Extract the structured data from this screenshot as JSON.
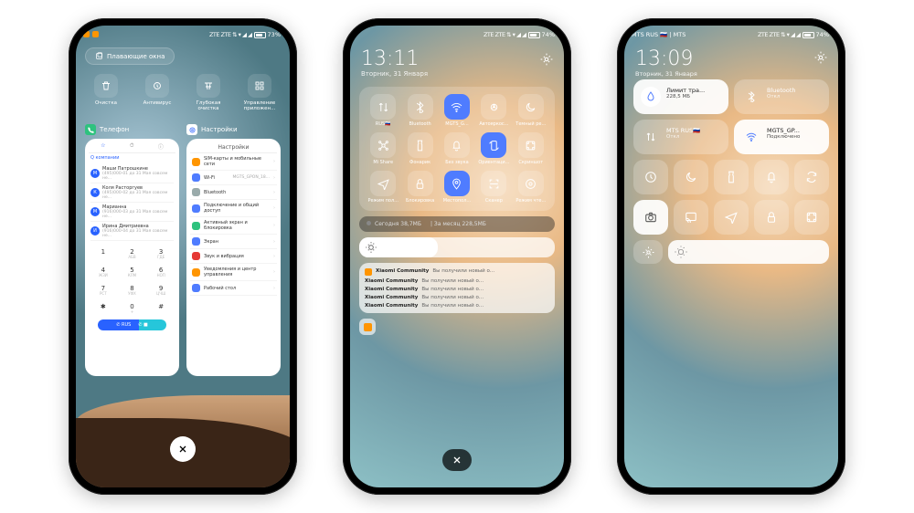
{
  "phone1": {
    "status": {
      "battery": "73%",
      "signals": "ZTE ZTE ⇅ ▾ ◢ ◢"
    },
    "pill": "Плавающие окна",
    "tools": [
      {
        "l": "Очистка",
        "i": "trash"
      },
      {
        "l": "Антивирус",
        "i": "shield"
      },
      {
        "l": "Глубокая очистка",
        "i": "broom"
      },
      {
        "l": "Управление приложен...",
        "i": "grid"
      }
    ],
    "card1": {
      "h": "Телефон",
      "tabs": [
        "☆",
        "⏱",
        "ⓘ"
      ],
      "search": "Q компании",
      "rows": [
        {
          "n": "Маши Патрошкине",
          "m": "(495)000-01  до 31 Мая совсем не..."
        },
        {
          "n": "Коля Расторгуев",
          "m": "(495)000-02  до 31 Мая совсем не..."
        },
        {
          "n": "Марианна",
          "m": "(916)000-03  до 31 Мая совсем не..."
        },
        {
          "n": "Ирина Дмитриевна",
          "m": "(916)000-04  до 31 Мая совсем не..."
        }
      ],
      "keys": [
        "1",
        "2",
        "3",
        "4",
        "5",
        "6",
        "7",
        "8",
        "9",
        "✱",
        "0",
        "#"
      ],
      "subs": [
        "",
        "АБВ",
        "ГДЕ",
        "ЖЗИ",
        "КЛМ",
        "НОП",
        "РСТ",
        "УФХ",
        "ЦЧШ",
        "",
        "+",
        ""
      ]
    },
    "card2": {
      "h": "Настройки",
      "title": "Настройки",
      "rows": [
        {
          "c": "#ff9500",
          "l": "SIM-карты и мобильные сети"
        },
        {
          "c": "#4f7cff",
          "l": "Wi-Fi",
          "r": "MGTS_GPON_18..."
        },
        {
          "c": "#9aa",
          "l": "Bluetooth"
        },
        {
          "c": "#4f7cff",
          "l": "Подключение и общий доступ"
        },
        {
          "c": "#2ec27e",
          "l": "Активный экран и блокировка"
        },
        {
          "c": "#4f7cff",
          "l": "Экран"
        },
        {
          "c": "#e53935",
          "l": "Звук и вибрация"
        },
        {
          "c": "#ff9500",
          "l": "Уведомления и центр управления"
        },
        {
          "c": "#4f7cff",
          "l": "Рабочий стол"
        }
      ]
    }
  },
  "phone2": {
    "status": {
      "battery": "74%"
    },
    "clock": "13:11",
    "date": "Вторник, 31 Января",
    "qs": [
      {
        "l": "RUS🇷🇺",
        "i": "data",
        "on": 0
      },
      {
        "l": "Bluetooth",
        "i": "bt",
        "on": 0
      },
      {
        "l": "MGTS_G...",
        "i": "wifi",
        "on": 1
      },
      {
        "l": "Автояркос...",
        "i": "auto",
        "on": 0
      },
      {
        "l": "Темный ре...",
        "i": "moon",
        "on": 0
      },
      {
        "l": "Mi Share",
        "i": "share",
        "on": 0
      },
      {
        "l": "Фонарик",
        "i": "torch",
        "on": 0
      },
      {
        "l": "Без звука",
        "i": "bell",
        "on": 0
      },
      {
        "l": "Ориентаци...",
        "i": "rotate",
        "on": 1
      },
      {
        "l": "Скриншот",
        "i": "shot",
        "on": 0
      },
      {
        "l": "Режим пол...",
        "i": "plane",
        "on": 0
      },
      {
        "l": "Блокировка",
        "i": "lock",
        "on": 0
      },
      {
        "l": "Местопол...",
        "i": "loc",
        "on": 1
      },
      {
        "l": "Сканер",
        "i": "scan",
        "on": 0
      },
      {
        "l": "Режим чте...",
        "i": "read",
        "on": 0
      }
    ],
    "data": {
      "a": "Сегодня 38,7МБ",
      "b": "За месяц 228,5МБ"
    },
    "notifs": [
      {
        "t": "Xiaomi Community",
        "m": "Вы получили новый о..."
      },
      {
        "t": "Xiaomi Community",
        "m": "Вы получили новый о..."
      },
      {
        "t": "Xiaomi Community",
        "m": "Вы получили новый о..."
      },
      {
        "t": "Xiaomi Community",
        "m": "Вы получили новый о..."
      },
      {
        "t": "Xiaomi Community",
        "m": "Вы получили новый о..."
      }
    ]
  },
  "phone3": {
    "status": {
      "left": "MTS RUS 🇷🇺 | MTS",
      "battery": "74%"
    },
    "clock": "13:09",
    "date": "Вторник, 31 Января",
    "top": [
      {
        "t1": "Лимит тра...",
        "t2": "228,5 МБ",
        "i": "blood",
        "on": 1,
        "cls": "blood"
      },
      {
        "t1": "Bluetooth",
        "t2": "Откл",
        "i": "bt",
        "on": 0
      }
    ],
    "mid": [
      {
        "t1": "MTS RUS🇷🇺",
        "t2": "Откл",
        "i": "data",
        "on": 0
      },
      {
        "t1": "MGTS_GP...",
        "t2": "Подключено",
        "i": "wifi",
        "on": 1
      }
    ],
    "grid": [
      "clock",
      "moon",
      "torch",
      "bell",
      "sync",
      "camera",
      "cast",
      "plane",
      "lock",
      "shot"
    ]
  }
}
